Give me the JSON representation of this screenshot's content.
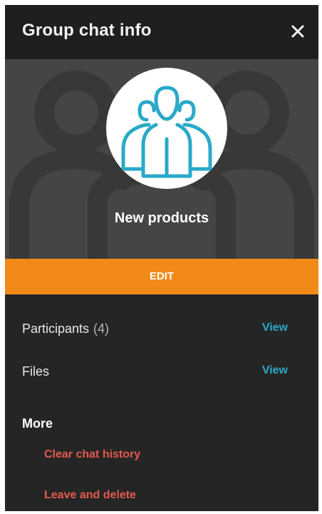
{
  "header": {
    "title": "Group chat info",
    "close_icon": "close-icon"
  },
  "group": {
    "name": "New products",
    "avatar_icon": "group-people-icon",
    "avatar_color": "#2aa9c8"
  },
  "edit": {
    "label": "EDIT",
    "color": "#f28a17"
  },
  "participants": {
    "label": "Participants",
    "count": "(4)",
    "action": "View"
  },
  "files": {
    "label": "Files",
    "action": "View"
  },
  "more": {
    "heading": "More",
    "actions": [
      {
        "label": "Clear chat history"
      },
      {
        "label": "Leave and delete"
      }
    ]
  },
  "colors": {
    "panel_bg": "#252525",
    "link": "#2aa9c8",
    "danger": "#e55a4f"
  }
}
